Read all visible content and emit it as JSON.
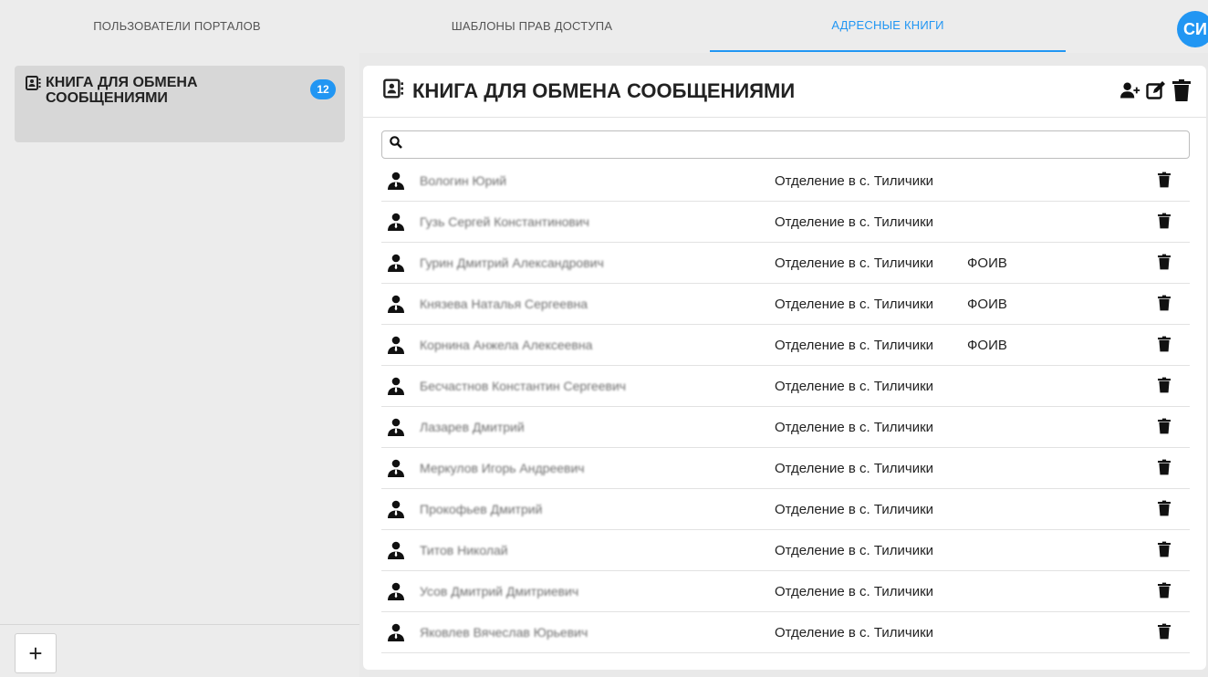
{
  "tabs": [
    {
      "label": "ПОЛЬЗОВАТЕЛИ ПОРТАЛОВ"
    },
    {
      "label": "ШАБЛОНЫ ПРАВ ДОСТУПА"
    },
    {
      "label": "АДРЕСНЫЕ КНИГИ",
      "active": true
    }
  ],
  "user": {
    "initials": "СИ"
  },
  "sidebar": {
    "books": [
      {
        "title": "КНИГА ДЛЯ ОБМЕНА СООБЩЕНИЯМИ",
        "count": "12",
        "icon": "address-book-icon"
      }
    ],
    "add_label": "+"
  },
  "main": {
    "title": "КНИГА ДЛЯ ОБМЕНА СООБЩЕНИЯМИ",
    "actions": [
      "add-user-icon",
      "edit-icon",
      "trash-icon"
    ],
    "search": {
      "value": "",
      "placeholder": ""
    },
    "contacts": [
      {
        "name": "Вологин Юрий",
        "dept": "Отделение в с. Тиличики",
        "tag": ""
      },
      {
        "name": "Гузь Сергей Константинович",
        "dept": "Отделение в с. Тиличики",
        "tag": ""
      },
      {
        "name": "Гурин Дмитрий Александрович",
        "dept": "Отделение в с. Тиличики",
        "tag": "ФОИВ"
      },
      {
        "name": "Князева Наталья Сергеевна",
        "dept": "Отделение в с. Тиличики",
        "tag": "ФОИВ"
      },
      {
        "name": "Корнина Анжела Алексеевна",
        "dept": "Отделение в с. Тиличики",
        "tag": "ФОИВ"
      },
      {
        "name": "Бесчастнов Константин Сергеевич",
        "dept": "Отделение в с. Тиличики",
        "tag": ""
      },
      {
        "name": "Лазарев Дмитрий",
        "dept": "Отделение в с. Тиличики",
        "tag": ""
      },
      {
        "name": "Меркулов Игорь Андреевич",
        "dept": "Отделение в с. Тиличики",
        "tag": ""
      },
      {
        "name": "Прокофьев Дмитрий",
        "dept": "Отделение в с. Тиличики",
        "tag": ""
      },
      {
        "name": "Титов Николай",
        "dept": "Отделение в с. Тиличики",
        "tag": ""
      },
      {
        "name": "Усов Дмитрий Дмитриевич",
        "dept": "Отделение в с. Тиличики",
        "tag": ""
      },
      {
        "name": "Яковлев Вячеслав Юрьевич",
        "dept": "Отделение в с. Тиличики",
        "tag": ""
      }
    ]
  },
  "colors": {
    "accent": "#2196f3",
    "text": "#222222",
    "background": "#ececec",
    "panel": "#ffffff"
  }
}
